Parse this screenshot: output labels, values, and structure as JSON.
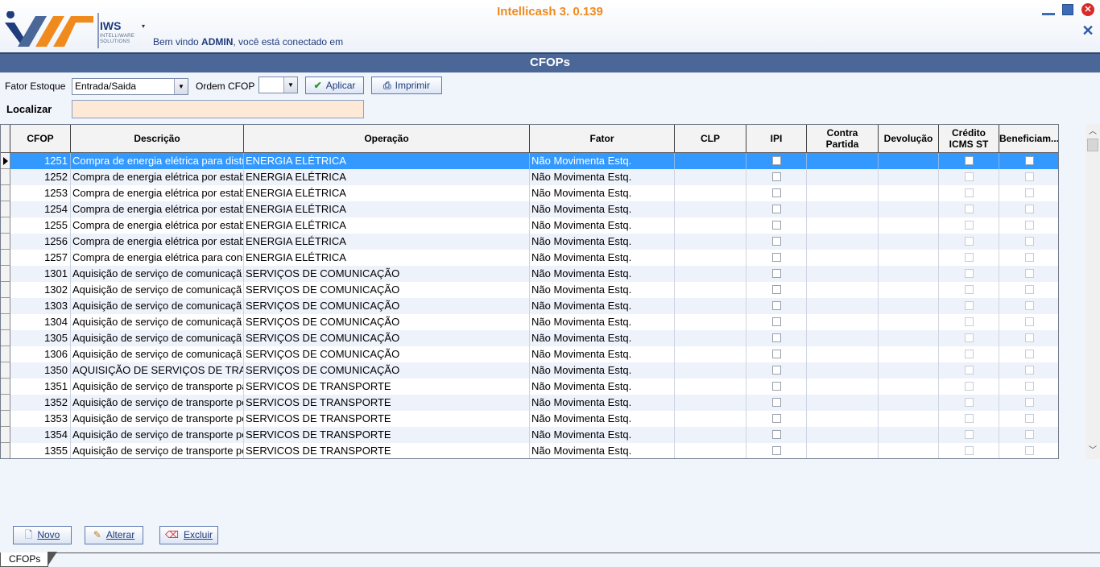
{
  "app": {
    "title": "Intellicash 3. 0.139",
    "logo_text": "IWS",
    "logo_sub": "INTELLIWARE SOLUTIONS",
    "welcome_prefix": "Bem vindo ",
    "welcome_user": "ADMIN",
    "welcome_suffix": ", você está conectado em"
  },
  "window": {
    "title": "CFOPs"
  },
  "filters": {
    "fator_label": "Fator Estoque",
    "fator_value": "Entrada/Saida",
    "ordem_label": "Ordem CFOP",
    "ordem_value": "",
    "apply_label": "Aplicar",
    "print_label": "Imprimir",
    "search_label": "Localizar",
    "search_value": ""
  },
  "grid": {
    "columns": [
      "CFOP",
      "Descrição",
      "Operação",
      "Fator",
      "CLP",
      "IPI",
      "Contra Partida",
      "Devolução",
      "Crédito ICMS ST",
      "Beneficiam..."
    ],
    "rows": [
      {
        "cfop": "1251",
        "desc": "Compra de energia elétrica para distr",
        "op": "ENERGIA ELÉTRICA",
        "fator": "Não Movimenta Estq."
      },
      {
        "cfop": "1252",
        "desc": "Compra de energia elétrica por estab",
        "op": "ENERGIA ELÉTRICA",
        "fator": "Não Movimenta Estq."
      },
      {
        "cfop": "1253",
        "desc": "Compra de energia elétrica por estab",
        "op": "ENERGIA ELÉTRICA",
        "fator": "Não Movimenta Estq."
      },
      {
        "cfop": "1254",
        "desc": "Compra de energia elétrica por estab",
        "op": "ENERGIA ELÉTRICA",
        "fator": "Não Movimenta Estq."
      },
      {
        "cfop": "1255",
        "desc": "Compra de energia elétrica por estab",
        "op": "ENERGIA ELÉTRICA",
        "fator": "Não Movimenta Estq."
      },
      {
        "cfop": "1256",
        "desc": "Compra de energia elétrica por estab",
        "op": "ENERGIA ELÉTRICA",
        "fator": "Não Movimenta Estq."
      },
      {
        "cfop": "1257",
        "desc": "Compra de energia elétrica para cons",
        "op": "ENERGIA ELÉTRICA",
        "fator": "Não Movimenta Estq."
      },
      {
        "cfop": "1301",
        "desc": "Aquisição de serviço de comunicaçã",
        "op": "SERVIÇOS DE COMUNICAÇÃO",
        "fator": "Não Movimenta Estq."
      },
      {
        "cfop": "1302",
        "desc": "Aquisição de serviço de comunicaçã",
        "op": "SERVIÇOS DE COMUNICAÇÃO",
        "fator": "Não Movimenta Estq."
      },
      {
        "cfop": "1303",
        "desc": "Aquisição de serviço de comunicaçã",
        "op": "SERVIÇOS DE COMUNICAÇÃO",
        "fator": "Não Movimenta Estq."
      },
      {
        "cfop": "1304",
        "desc": "Aquisição de serviço de comunicaçã",
        "op": "SERVIÇOS DE COMUNICAÇÃO",
        "fator": "Não Movimenta Estq."
      },
      {
        "cfop": "1305",
        "desc": "Aquisição de serviço de comunicaçã",
        "op": "SERVIÇOS DE COMUNICAÇÃO",
        "fator": "Não Movimenta Estq."
      },
      {
        "cfop": "1306",
        "desc": "Aquisição de serviço de comunicaçã",
        "op": "SERVIÇOS DE COMUNICAÇÃO",
        "fator": "Não Movimenta Estq."
      },
      {
        "cfop": "1350",
        "desc": "AQUISIÇÃO DE SERVIÇOS DE TRA",
        "op": "SERVIÇOS DE COMUNICAÇÃO",
        "fator": "Não Movimenta Estq."
      },
      {
        "cfop": "1351",
        "desc": "Aquisição de serviço de transporte pa",
        "op": "SERVICOS DE TRANSPORTE",
        "fator": "Não Movimenta Estq."
      },
      {
        "cfop": "1352",
        "desc": "Aquisição de serviço de transporte po",
        "op": "SERVICOS DE TRANSPORTE",
        "fator": "Não Movimenta Estq."
      },
      {
        "cfop": "1353",
        "desc": "Aquisição de serviço de transporte po",
        "op": "SERVICOS DE TRANSPORTE",
        "fator": "Não Movimenta Estq."
      },
      {
        "cfop": "1354",
        "desc": "Aquisição de serviço de transporte po",
        "op": "SERVICOS DE TRANSPORTE",
        "fator": "Não Movimenta Estq."
      },
      {
        "cfop": "1355",
        "desc": "Aquisição de serviço de transporte po",
        "op": "SERVICOS DE TRANSPORTE",
        "fator": "Não Movimenta Estq."
      }
    ]
  },
  "actions": {
    "novo": "Novo",
    "alterar": "Alterar",
    "excluir": "Excluir"
  },
  "tabs": {
    "active": "CFOPs"
  },
  "colors": {
    "accent": "#f08a1c",
    "titlebar": "#4a6798",
    "selection": "#3399ff",
    "search_bg": "#fde9d6"
  }
}
